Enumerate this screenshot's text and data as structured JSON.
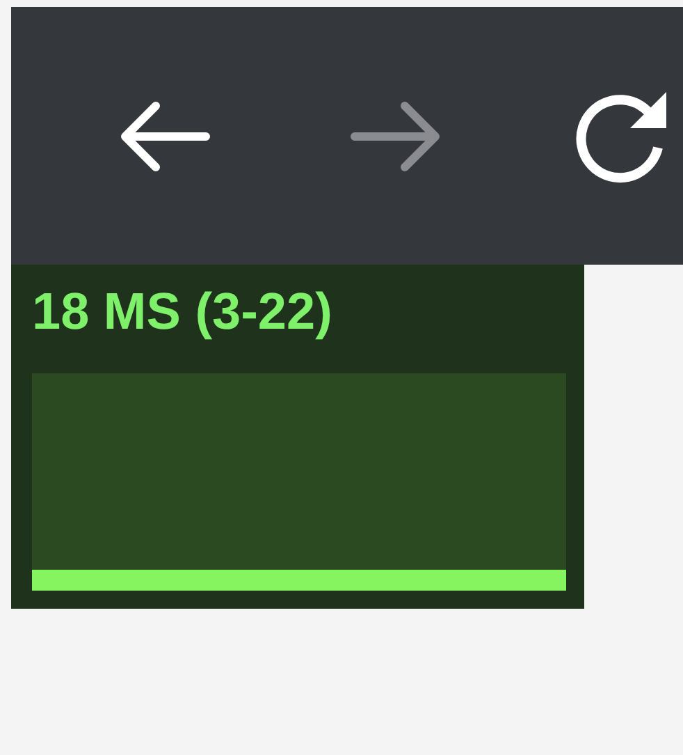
{
  "toolbar": {
    "buttons": [
      {
        "kind": "back",
        "disabled": false
      },
      {
        "kind": "forward",
        "disabled": true
      },
      {
        "kind": "reload",
        "disabled": false
      }
    ]
  },
  "stats_panel": {
    "reading": "18 MS (3-22)"
  }
}
